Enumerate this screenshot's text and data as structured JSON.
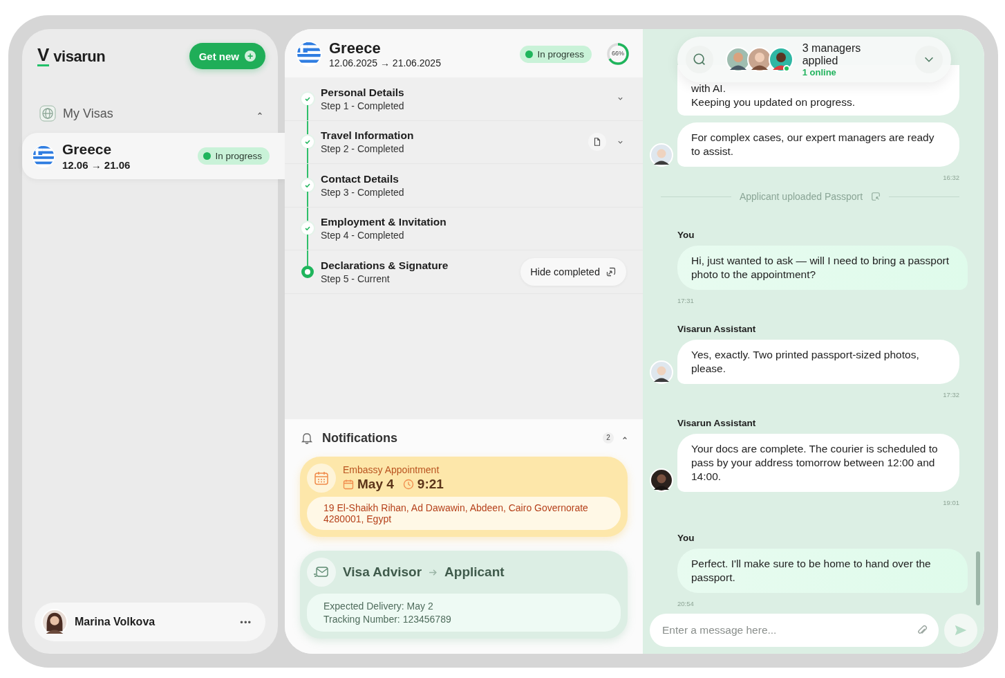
{
  "brand": {
    "mark": "V",
    "name": "visarun"
  },
  "get_new_button": {
    "label": "Get new",
    "icon": "+"
  },
  "sidebar": {
    "section": {
      "label": "My Visas",
      "expanded": true
    },
    "visas": [
      {
        "country": "Greece",
        "from": "12.06",
        "arrow": "→",
        "to": "21.06",
        "status": "In progress",
        "selected": true
      }
    ]
  },
  "user": {
    "name": "Marina Volkova",
    "menu": "•••"
  },
  "header": {
    "country": "Greece",
    "from": "12.06.2025",
    "arrow": "→",
    "to": "21.06.2025",
    "status": "In progress",
    "progress_label": "66%",
    "level": 0.66
  },
  "steps": [
    {
      "title": "Personal Details",
      "subtitle": "Step 1 - Completed",
      "current": false,
      "has_document": false,
      "expandable": true
    },
    {
      "title": "Travel Information",
      "subtitle": "Step 2 - Completed",
      "current": false,
      "has_document": true,
      "expandable": true
    },
    {
      "title": "Contact Details",
      "subtitle": "Step 3 - Completed",
      "current": false,
      "has_document": false,
      "expandable": false
    },
    {
      "title": "Employment & Invitation",
      "subtitle": "Step 4 - Completed",
      "current": false,
      "has_document": false,
      "expandable": false
    },
    {
      "title": "Declarations & Signature",
      "subtitle": "Step 5 - Current",
      "current": true,
      "has_document": false,
      "expandable": false
    }
  ],
  "hide_completed_button": "Hide completed",
  "notifications": {
    "title": "Notifications",
    "count": "2",
    "expanded": true,
    "items": [
      {
        "kind": "appointment",
        "title": "Embassy Appointment",
        "date": "May 4",
        "time": "9:21",
        "address": "19 El-Shaikh Rihan, Ad Dawawin, Abdeen, Cairo Governorate 4280001, Egypt"
      },
      {
        "kind": "delivery",
        "from": "Visa Advisor",
        "to": "Applicant",
        "lines": [
          "Expected Delivery: May 2",
          "Tracking Number: 123456789"
        ]
      }
    ]
  },
  "chat": {
    "managers": {
      "label": "3 managers applied",
      "online": "1 online"
    },
    "messages": [
      {
        "kind": "incoming",
        "text": "with AI.\nKeeping you updated on progress.",
        "avatar": false
      },
      {
        "kind": "incoming",
        "text": "For complex cases, our expert managers are ready to assist.",
        "avatar": true,
        "time": "16:32"
      },
      {
        "kind": "event",
        "text": "Applicant uploaded Passport"
      },
      {
        "kind": "outgoing",
        "sender": "You",
        "text": "Hi, just wanted to ask — will I need to bring a passport photo to the appointment?",
        "time": "17:31"
      },
      {
        "kind": "incoming",
        "sender": "Visarun Assistant",
        "text": "Yes, exactly. Two printed passport-sized photos, please.",
        "avatar": true,
        "time": "17:32"
      },
      {
        "kind": "incoming",
        "sender": "Visarun Assistant",
        "text": "Your docs are complete. The courier is scheduled to pass by your address tomorrow between 12:00 and 14:00.",
        "avatar": true,
        "time": "19:01"
      },
      {
        "kind": "outgoing",
        "sender": "You",
        "text": "Perfect. I'll make sure to be home to hand over the passport.",
        "time": "20:54"
      }
    ],
    "composer": {
      "placeholder": "Enter a message here..."
    }
  }
}
